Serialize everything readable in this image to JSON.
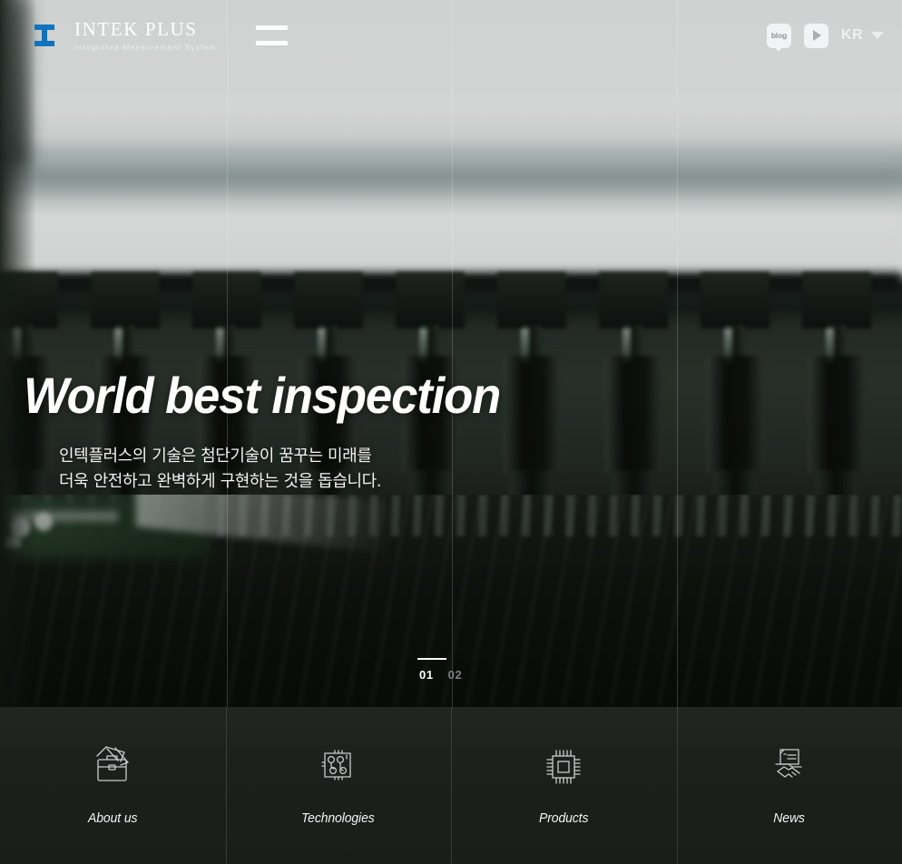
{
  "header": {
    "logo": {
      "name": "INTEK PLUS",
      "tagline": "Integrated  Measurement  System",
      "mark_icon": "intek-wave-i-icon"
    },
    "menu_icon": "hamburger-menu-icon",
    "blog": {
      "label": "blog",
      "icon": "blog-icon"
    },
    "youtube": {
      "icon": "youtube-play-icon"
    },
    "language": {
      "selected": "KR",
      "caret_icon": "chevron-down-icon"
    }
  },
  "hero": {
    "headline": "World best inspection",
    "sub_line_1": "인텍플러스의 기술은 첨단기술이 꿈꾸는 미래를",
    "sub_line_2": "더욱 안전하고 완벽하게 구현하는 것을 돕습니다.",
    "slides": [
      {
        "number": "01",
        "state": "active"
      },
      {
        "number": "02",
        "state": "idle"
      }
    ]
  },
  "quicknav": {
    "items": [
      {
        "label": "About us",
        "icon": "briefcase-documents-icon"
      },
      {
        "label": "Technologies",
        "icon": "circuit-board-icon"
      },
      {
        "label": "Products",
        "icon": "cpu-chip-icon"
      },
      {
        "label": "News",
        "icon": "handshake-document-icon"
      }
    ]
  },
  "colors": {
    "accent_blue": "#1f7fc4",
    "panel_dark": "#1d1f1d",
    "text_light": "#f2f3f4",
    "slide_idle": "#7c7f80"
  }
}
